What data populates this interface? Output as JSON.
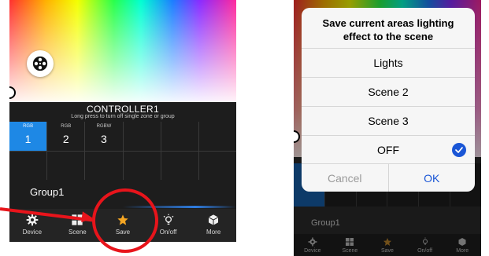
{
  "left_screen": {
    "controller_title": "CONTROLLER1",
    "controller_hint": "Long press to turn off single zone or group",
    "zones": [
      {
        "type": "RGB",
        "number": "1"
      },
      {
        "type": "RGB",
        "number": "2"
      },
      {
        "type": "RGBW",
        "number": "3"
      }
    ],
    "group_label": "Group1",
    "tabs": [
      {
        "label": "Device",
        "icon": "gear-icon"
      },
      {
        "label": "Scene",
        "icon": "grid-icon"
      },
      {
        "label": "Save",
        "icon": "star-icon"
      },
      {
        "label": "On/off",
        "icon": "bulb-icon"
      },
      {
        "label": "More",
        "icon": "cube-icon"
      }
    ],
    "accent_color": "#1e88e5",
    "save_accent_color": "#f5a623",
    "annotation_color": "#e8141b"
  },
  "right_screen": {
    "dialog": {
      "title": "Save current areas lighting effect to the scene",
      "options": [
        "Lights",
        "Scene 2",
        "Scene 3",
        "OFF"
      ],
      "selected_option": "OFF",
      "cancel_label": "Cancel",
      "ok_label": "OK"
    },
    "group_label": "Group1",
    "tabs": [
      {
        "label": "Device",
        "icon": "gear-icon"
      },
      {
        "label": "Scene",
        "icon": "grid-icon"
      },
      {
        "label": "Save",
        "icon": "star-icon"
      },
      {
        "label": "On/off",
        "icon": "bulb-icon"
      },
      {
        "label": "More",
        "icon": "cube-icon"
      }
    ],
    "check_color": "#1a56d6"
  }
}
